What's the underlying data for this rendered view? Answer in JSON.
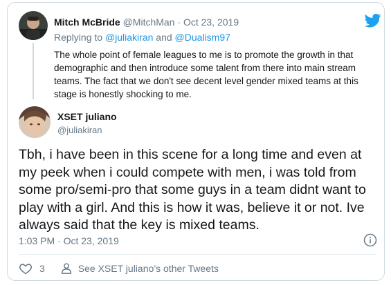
{
  "parent_tweet": {
    "author_name": "Mitch McBride",
    "author_handle": "@MitchMan",
    "separator": "·",
    "date": "Oct 23, 2019",
    "replying_prefix": "Replying to",
    "mention_1": "@juliakiran",
    "and_word": "and",
    "mention_2": "@Dualism97",
    "text": "The whole point of female leagues to me is to promote the growth in that demographic and then introduce some talent from there into main stream teams. The fact that we don't see decent level gender mixed teams at this stage is honestly shocking to me."
  },
  "main_tweet": {
    "author_name": "XSET juliano",
    "author_handle": "@juliakiran",
    "text": "Tbh, i have been in this scene for a long time and even at my peek when i could compete with men, i was told from some pro/semi-pro that some guys in a team didnt want to play with a girl. And this is how it was, believe it or not. Ive always said that the key is mixed teams.",
    "timestamp": "1:03 PM · Oct 23, 2019",
    "like_count": "3",
    "see_other_tweets": "See XSET juliano’s other Tweets"
  },
  "icons": {
    "brand": "twitter-bird-icon",
    "info": "info-icon",
    "like": "heart-icon",
    "profile": "user-icon"
  },
  "colors": {
    "brand_blue": "#1da1f2",
    "link_blue": "#1b95e0",
    "secondary_text": "#657786",
    "border": "#cfd9de"
  }
}
